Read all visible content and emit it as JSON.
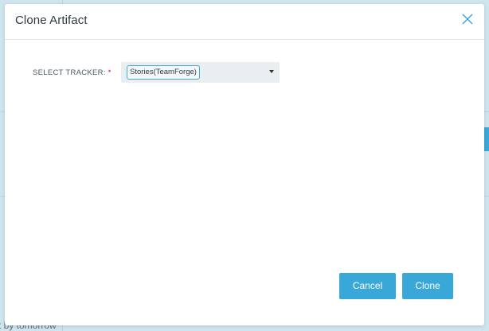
{
  "background": {
    "partial_text": "t by tomorrow"
  },
  "modal": {
    "title": "Clone Artifact",
    "close_icon": "close-icon"
  },
  "form": {
    "tracker_label": "SELECT TRACKER:",
    "required_marker": "*",
    "tracker_value": "Stories(TeamForge)"
  },
  "actions": {
    "cancel_label": "Cancel",
    "clone_label": "Clone"
  },
  "colors": {
    "accent": "#39a8d8",
    "required": "#d0021b"
  }
}
